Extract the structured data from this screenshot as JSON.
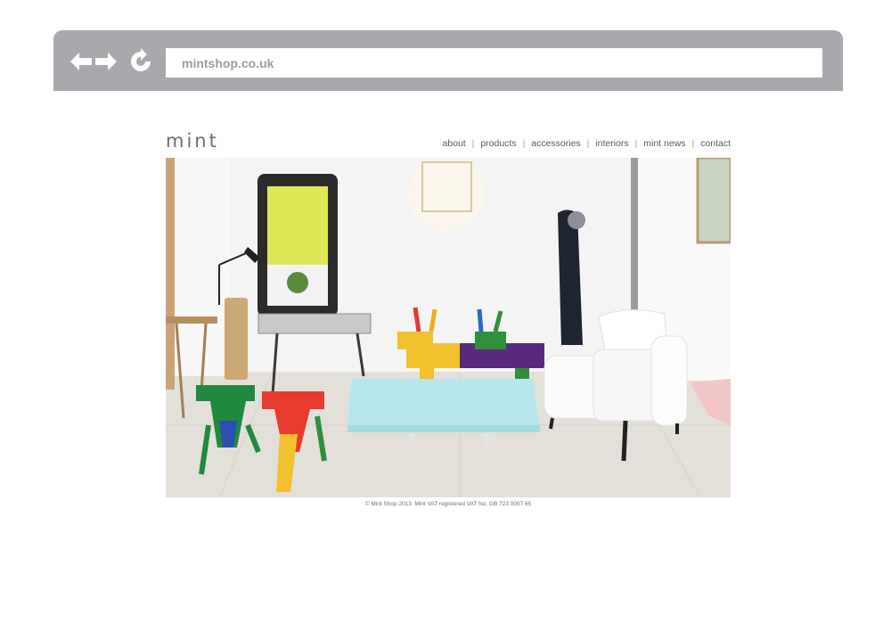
{
  "browser": {
    "url": "mintshop.co.uk",
    "back_icon": "arrow-left-icon",
    "forward_icon": "arrow-right-icon",
    "reload_icon": "reload-icon",
    "bar_color": "#a7a9ac"
  },
  "site": {
    "logo": "mint",
    "nav": [
      {
        "label": "about"
      },
      {
        "label": "products"
      },
      {
        "label": "accessories"
      },
      {
        "label": "interiors"
      },
      {
        "label": "mint news"
      },
      {
        "label": "contact"
      }
    ],
    "footer": "© Mint Shop 2013. Mint VAT registered VAT No. GB 723 0097 65"
  }
}
